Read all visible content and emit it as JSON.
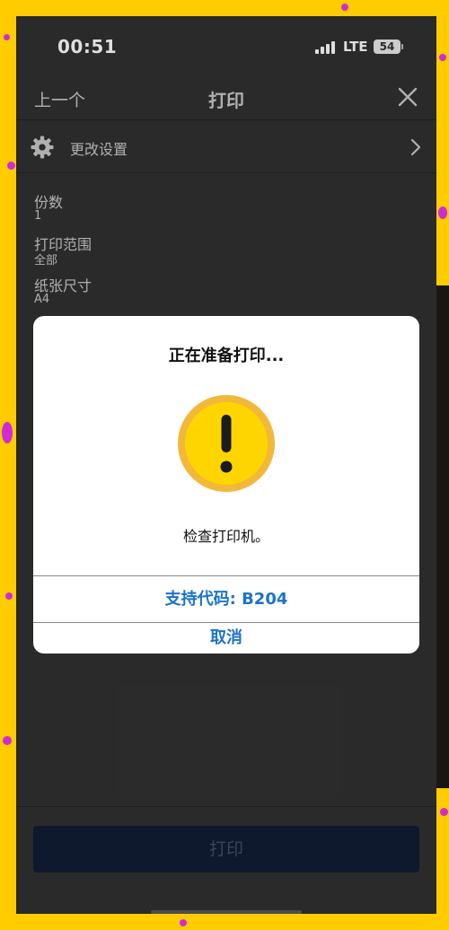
{
  "status_bar": {
    "time": "00:51",
    "network": "LTE",
    "battery": "54"
  },
  "nav": {
    "prev_label": "上一个",
    "title": "打印",
    "close_icon": "close-icon"
  },
  "settings": {
    "icon": "gear-icon",
    "label": "更改设置",
    "chevron": "chevron-right-icon"
  },
  "print_options": [
    {
      "label": "份数",
      "value": "1"
    },
    {
      "label": "打印范围",
      "value": "全部"
    },
    {
      "label": "纸张尺寸",
      "value": "A4"
    }
  ],
  "footer": {
    "print_label": "打印"
  },
  "dialog": {
    "title": "正在准备打印...",
    "icon": "warning-icon",
    "message": "检查打印机。",
    "support_code_label": "支持代码: B204",
    "cancel_label": "取消"
  },
  "colors": {
    "background": "#ffcc00",
    "confetti": "#d02ad8",
    "screen": "#2b2b2b",
    "accent": "#1a73c9",
    "warning": "#f7c423",
    "print_button": "#0b1730"
  }
}
